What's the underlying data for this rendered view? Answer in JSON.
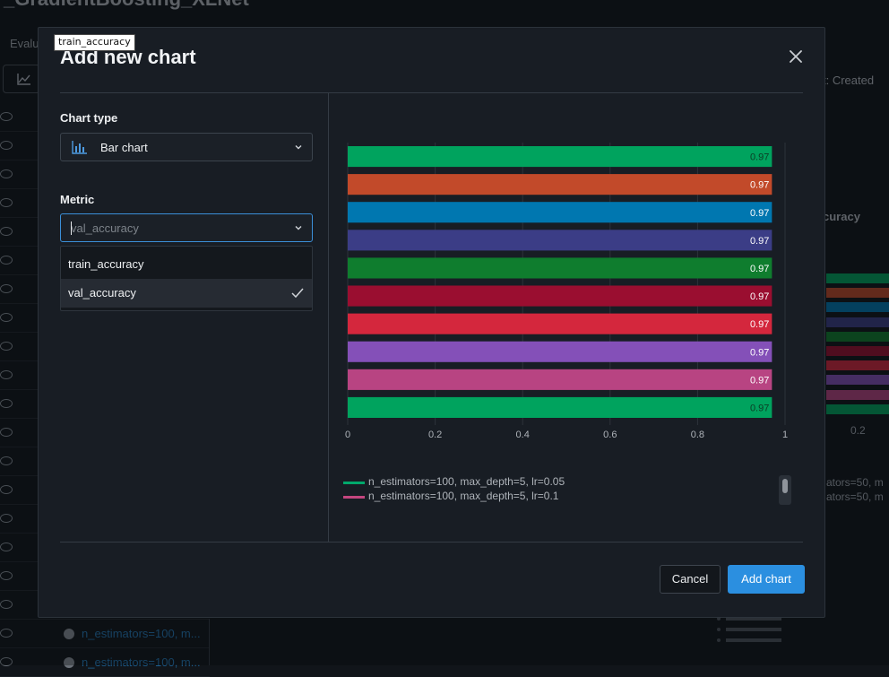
{
  "background": {
    "title": "_GradientBoosting_XLNet",
    "tab_label": "Evalu",
    "right_label": "t: Created",
    "right_sub_label": "curacy",
    "tick_label": "0.2",
    "legend_items": [
      "ators=50, m",
      "ators=50, m"
    ],
    "bottom_links": [
      "n_estimators=100, m...",
      "n_estimators=100, m..."
    ]
  },
  "modal": {
    "title": "Add new chart",
    "chart_type": {
      "label": "Chart type",
      "selected": "Bar chart",
      "icon": "bar-chart-icon"
    },
    "metric": {
      "label": "Metric",
      "placeholder": "val_accuracy",
      "options": [
        {
          "label": "train_accuracy",
          "selected": false
        },
        {
          "label": "val_accuracy",
          "selected": true
        }
      ]
    },
    "legend": [
      {
        "label": "n_estimators=100, max_depth=5, lr=0.05",
        "color": "#00a86b"
      },
      {
        "label": "n_estimators=100, max_depth=5, lr=0.1",
        "color": "#c4467f"
      }
    ],
    "buttons": {
      "cancel": "Cancel",
      "add": "Add chart"
    }
  },
  "tooltip": {
    "text": "train_accuracy"
  },
  "chart_data": {
    "type": "bar",
    "orientation": "horizontal",
    "xlim": [
      0,
      1
    ],
    "xticks": [
      0,
      0.2,
      0.4,
      0.6,
      0.8,
      1
    ],
    "xtick_labels": [
      "0",
      "0.2",
      "0.4",
      "0.6",
      "0.8",
      "1"
    ],
    "grid": true,
    "values": [
      0.97,
      0.97,
      0.97,
      0.97,
      0.97,
      0.97,
      0.97,
      0.97,
      0.97,
      0.97
    ],
    "data_labels": [
      "0.97",
      "0.97",
      "0.97",
      "0.97",
      "0.97",
      "0.97",
      "0.97",
      "0.97",
      "0.97",
      "0.97"
    ],
    "colors": [
      "#00a35e",
      "#c24a2a",
      "#0077b0",
      "#3b3d86",
      "#0f7d2e",
      "#9a0e30",
      "#d4273d",
      "#8450b8",
      "#b84482",
      "#00a35e"
    ],
    "label_colors": [
      "#0b3d24",
      "#ffffff",
      "#ffffff",
      "#ffffff",
      "#ffffff",
      "#ffffff",
      "#ffffff",
      "#ffffff",
      "#ffffff",
      "#0b3d24"
    ]
  }
}
